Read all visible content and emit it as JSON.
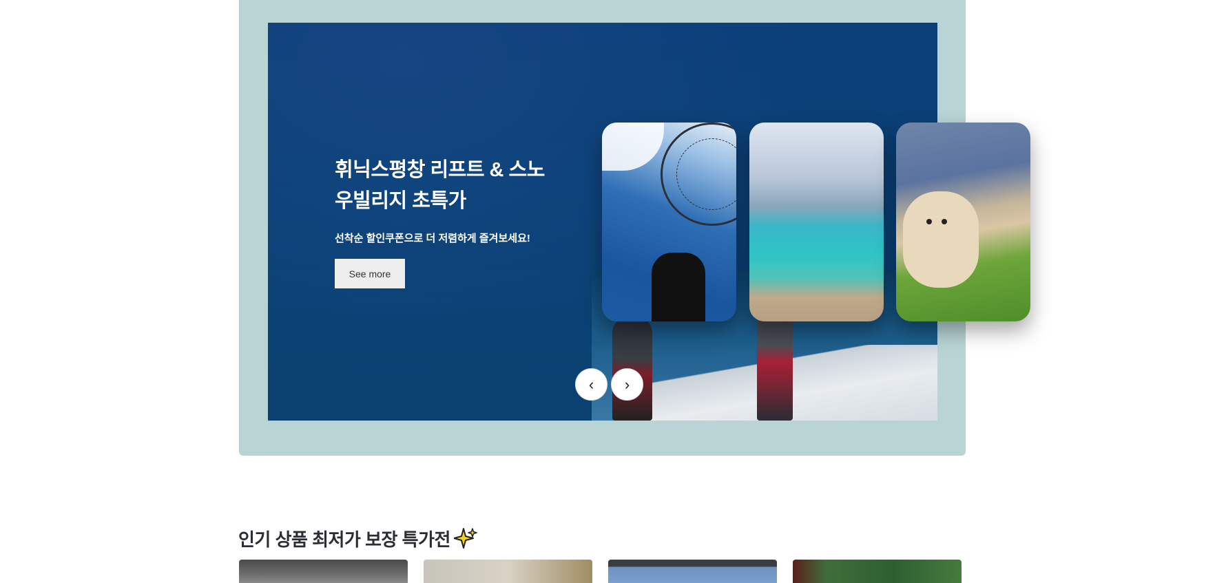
{
  "banner": {
    "headline": "휘닉스평창 리프트 & 스노우빌리지 초특가",
    "subtext": "선착순 할인쿠폰으로 더 저렴하게 즐겨보세요!",
    "cta_label": "See more",
    "prev_label": "‹",
    "next_label": "›",
    "colors": {
      "panel_bg": "#b9d4d5",
      "banner_bg": "#0a4276"
    }
  },
  "section": {
    "title": "인기 상품 최저가 보장 특가전"
  }
}
